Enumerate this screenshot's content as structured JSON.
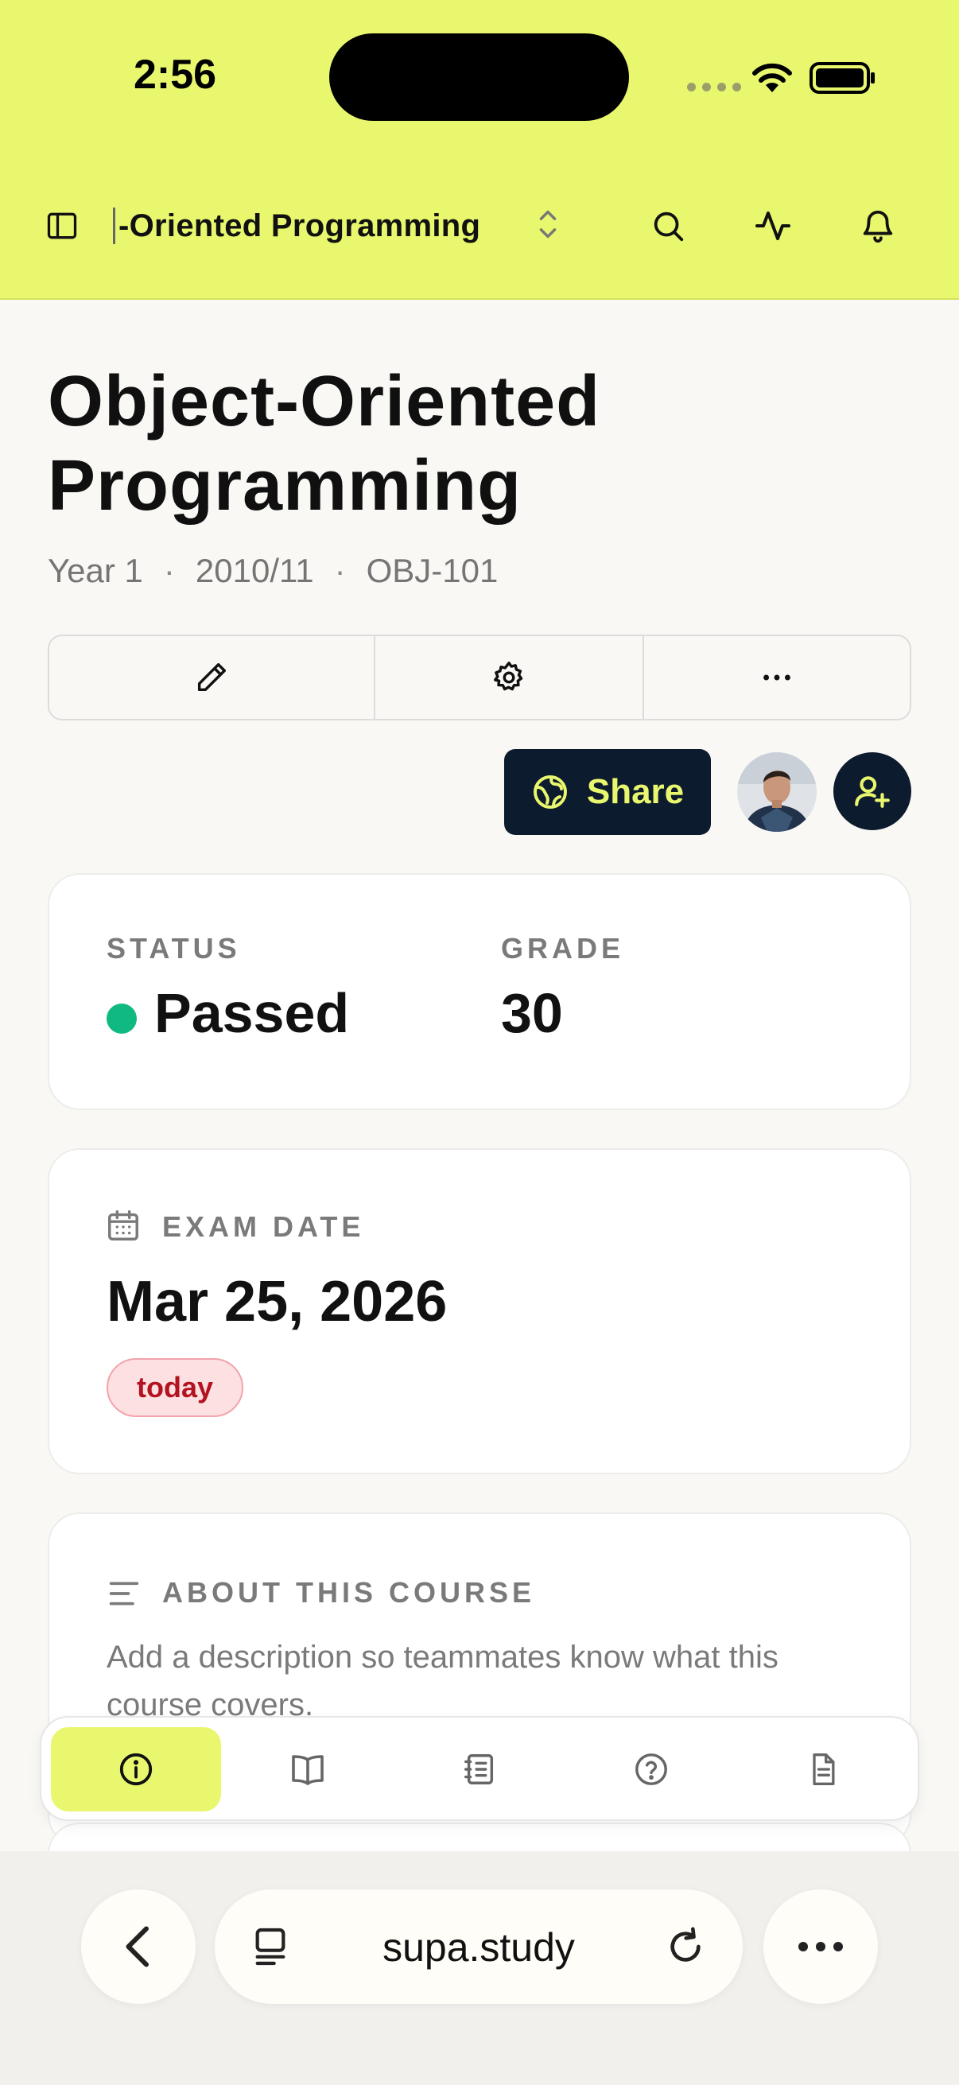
{
  "status_bar": {
    "time": "2:56"
  },
  "header": {
    "course_switcher_label": "-Oriented Programming"
  },
  "course": {
    "title": "Object-Oriented Programming",
    "year": "Year 1",
    "academic_year": "2010/11",
    "code": "OBJ-101",
    "meta_separator": "·"
  },
  "share": {
    "label": "Share"
  },
  "status_card": {
    "status_caption": "STATUS",
    "status_value": "Passed",
    "status_color": "#10b981",
    "grade_caption": "GRADE",
    "grade_value": "30"
  },
  "exam_card": {
    "caption": "EXAM DATE",
    "date": "Mar 25, 2026",
    "badge": "today"
  },
  "about_card": {
    "caption": "ABOUT THIS COURSE",
    "description": "Add a description so teammates know what this course covers."
  },
  "tabs": [
    {
      "icon": "info-icon",
      "active": true
    },
    {
      "icon": "book-icon",
      "active": false
    },
    {
      "icon": "notebook-icon",
      "active": false
    },
    {
      "icon": "help-icon",
      "active": false
    },
    {
      "icon": "document-icon",
      "active": false
    }
  ],
  "browser": {
    "url": "supa.study"
  },
  "colors": {
    "accent": "#e9f76e",
    "navy": "#0d1b2e",
    "badge_red": "#b3131f"
  }
}
